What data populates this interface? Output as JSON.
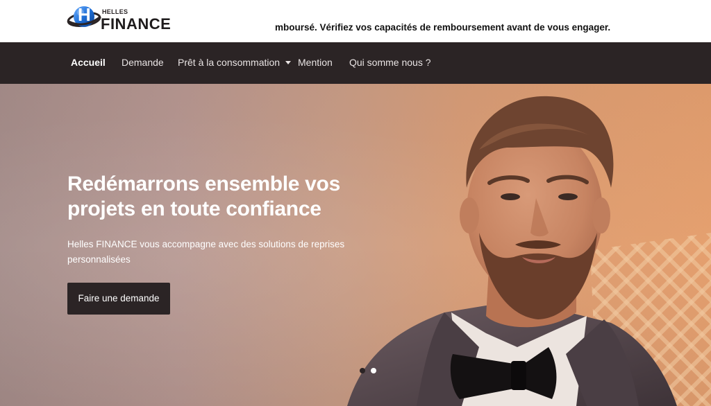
{
  "logo": {
    "letter": "H",
    "small_text": "HELLES",
    "big_text": "FINANCE",
    "accent_color": "#1f6fd6"
  },
  "ticker": {
    "text": "mboursé. Vérifiez vos capacités de remboursement avant de vous engager."
  },
  "nav": {
    "items": [
      {
        "label": "Accueil",
        "active": true
      },
      {
        "label": "Demande"
      },
      {
        "label": "Prêt à la consommation",
        "dropdown": true
      },
      {
        "label": "Mention"
      },
      {
        "label": "Qui somme nous ?"
      }
    ],
    "background": "#2b2425"
  },
  "hero": {
    "title_line1": "Redémarrons ensemble vos",
    "title_line2": "projets en toute confiance",
    "subtitle_line1": "Helles FINANCE vous accompagne avec des solutions de reprises",
    "subtitle_line2": "personnalisées",
    "cta_label": "Faire une demande",
    "slides_total": 2,
    "active_slide": 1
  }
}
